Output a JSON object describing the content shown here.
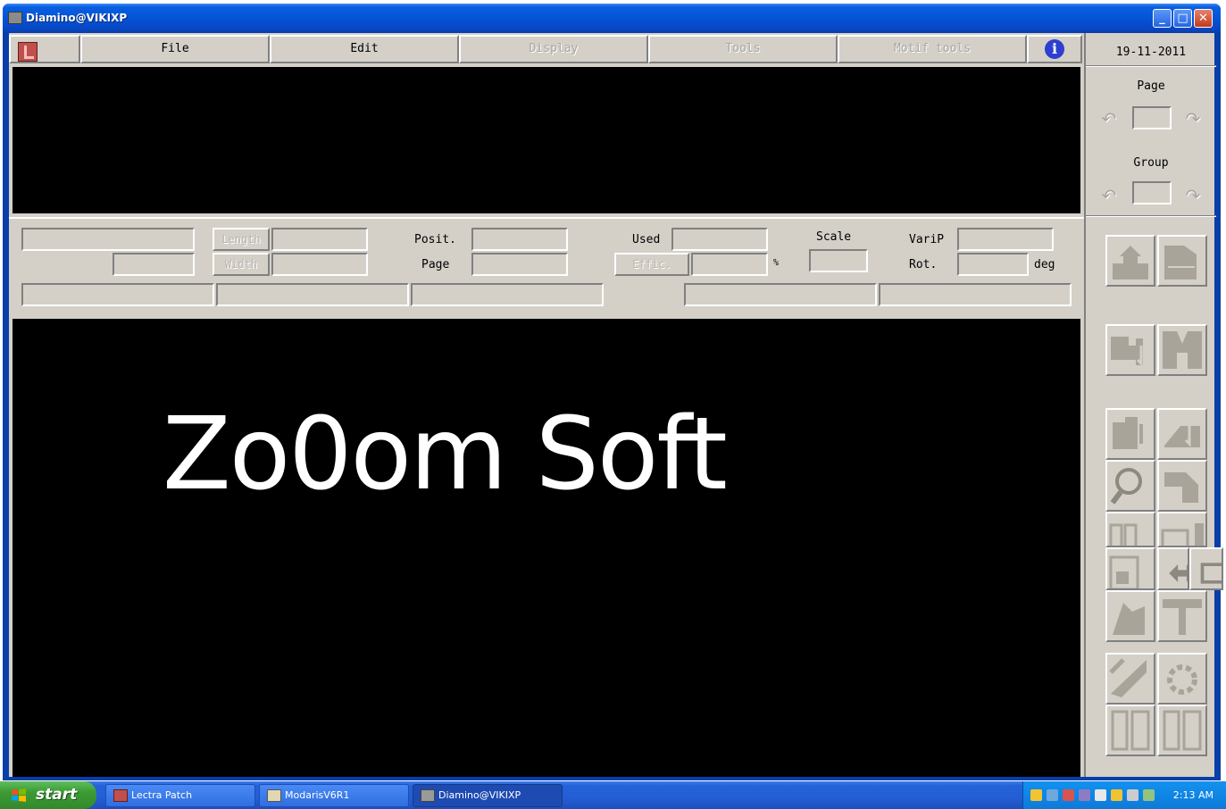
{
  "window": {
    "title": "Diamino@VIKIXP"
  },
  "menu": {
    "items": [
      {
        "label": "File",
        "enabled": true
      },
      {
        "label": "Edit",
        "enabled": true
      },
      {
        "label": "Display",
        "enabled": false
      },
      {
        "label": "Tools",
        "enabled": false
      },
      {
        "label": "Motif tools",
        "enabled": false
      }
    ],
    "info_icon": "info-icon"
  },
  "fields": {
    "length_label": "Length",
    "width_label": "Width",
    "posit_label": "Posit.",
    "page_label": "Page",
    "used_label": "Used",
    "effic_label": "Effic.",
    "percent_unit": "%",
    "scale_label": "Scale",
    "varip_label": "VariP",
    "rot_label": "Rot.",
    "deg_unit": "deg"
  },
  "sidebar": {
    "date": "19-11-2011",
    "page_label": "Page",
    "group_label": "Group"
  },
  "canvas": {
    "watermark": "Zo0om Soft"
  },
  "taskbar": {
    "start_label": "start",
    "tasks": [
      {
        "label": "Lectra Patch",
        "active": false
      },
      {
        "label": "ModarisV6R1",
        "active": false
      },
      {
        "label": "Diamino@VIKIXP",
        "active": true
      }
    ],
    "clock": "2:13 AM"
  }
}
